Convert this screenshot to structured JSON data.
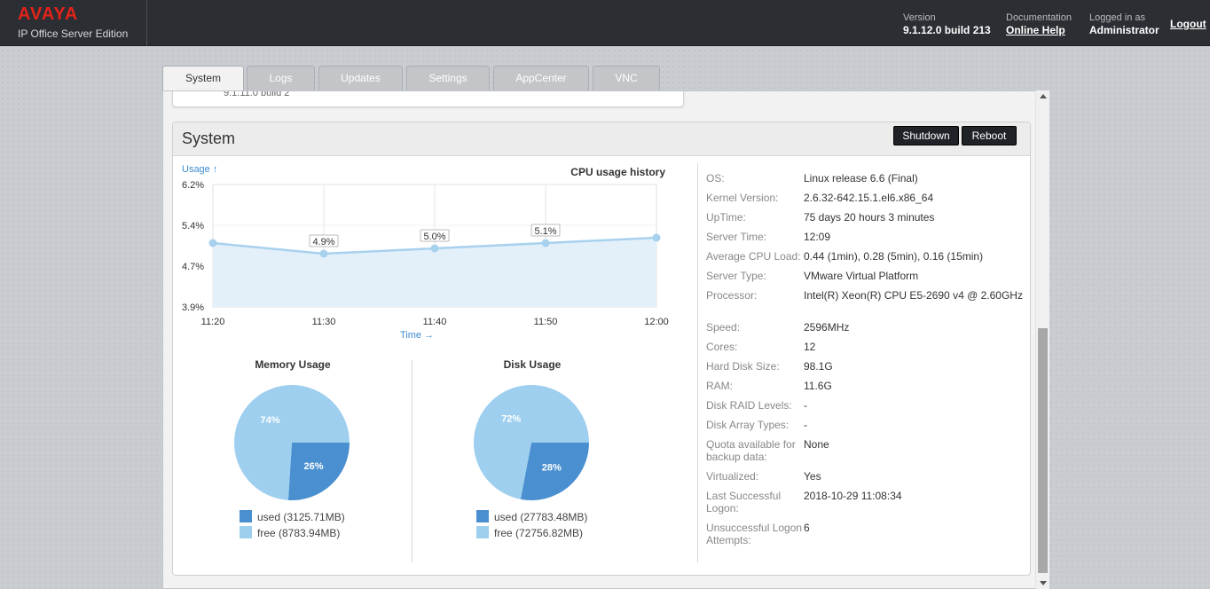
{
  "header": {
    "logo": "AVAYA",
    "product": "IP Office Server Edition",
    "version_label": "Version",
    "version_value": "9.1.12.0 build 213",
    "doc_label": "Documentation",
    "doc_link": "Online Help",
    "login_label": "Logged in as",
    "login_user": "Administrator",
    "logout": "Logout",
    "brand_color": "#e2231a"
  },
  "tabs": [
    {
      "label": "System"
    },
    {
      "label": "Logs"
    },
    {
      "label": "Updates"
    },
    {
      "label": "Settings"
    },
    {
      "label": "AppCenter"
    },
    {
      "label": "VNC"
    }
  ],
  "prev_card": {
    "text": "9.1.11.0 build 2"
  },
  "system_panel": {
    "title": "System",
    "shutdown": "Shutdown",
    "reboot": "Reboot"
  },
  "chart_data": [
    {
      "type": "area",
      "title": "CPU usage history",
      "xlabel": "Time →",
      "ylabel": "Usage ↑",
      "x": [
        "11:20",
        "11:30",
        "11:40",
        "11:50",
        "12:00"
      ],
      "y_ticks": [
        "6.2%",
        "5.4%",
        "4.7%",
        "3.9%"
      ],
      "ylim": [
        3.9,
        6.2
      ],
      "series": [
        {
          "values": [
            5.1,
            4.9,
            5.0,
            5.1,
            5.2
          ]
        }
      ],
      "point_labels": [
        "",
        "4.9%",
        "5.0%",
        "5.1%",
        ""
      ],
      "colors": {
        "line": "#a8d1ee",
        "fill": "#e3f0fa",
        "point": "#a8d1ee"
      },
      "grid": true
    },
    {
      "type": "pie",
      "title": "Memory Usage",
      "slices": [
        {
          "label": "used (3125.71MB)",
          "value": 26,
          "pct": "26%",
          "color": "#4a90d0"
        },
        {
          "label": "free (8783.94MB)",
          "value": 74,
          "pct": "74%",
          "color": "#9ecfef"
        }
      ]
    },
    {
      "type": "pie",
      "title": "Disk Usage",
      "slices": [
        {
          "label": "used (27783.48MB)",
          "value": 28,
          "pct": "28%",
          "color": "#4a90d0"
        },
        {
          "label": "free (72756.82MB)",
          "value": 72,
          "pct": "72%",
          "color": "#9ecfef"
        }
      ]
    }
  ],
  "system_info": [
    {
      "k": "OS:",
      "v": "Linux release 6.6 (Final)"
    },
    {
      "k": "Kernel Version:",
      "v": "2.6.32-642.15.1.el6.x86_64"
    },
    {
      "k": "UpTime:",
      "v": "75 days 20 hours 3 minutes"
    },
    {
      "k": "Server Time:",
      "v": "12:09"
    },
    {
      "k": "Average CPU Load:",
      "v": "0.44 (1min), 0.28 (5min), 0.16 (15min)"
    },
    {
      "k": "Server Type:",
      "v": "VMware Virtual Platform"
    },
    {
      "k": "Processor:",
      "v": "Intel(R) Xeon(R) CPU E5-2690 v4 @ 2.60GHz"
    },
    {
      "k": "Speed:",
      "v": "2596MHz"
    },
    {
      "k": "Cores:",
      "v": "12"
    },
    {
      "k": "Hard Disk Size:",
      "v": "98.1G"
    },
    {
      "k": "RAM:",
      "v": "11.6G"
    },
    {
      "k": "Disk RAID Levels:",
      "v": "-"
    },
    {
      "k": "Disk Array Types:",
      "v": "-"
    },
    {
      "k": "Quota available for backup data:",
      "v": "None"
    },
    {
      "k": "Virtualized:",
      "v": "Yes"
    },
    {
      "k": "Last Successful Logon:",
      "v": "2018-10-29 11:08:34"
    },
    {
      "k": "Unsuccessful Logon Attempts:",
      "v": "6"
    }
  ]
}
